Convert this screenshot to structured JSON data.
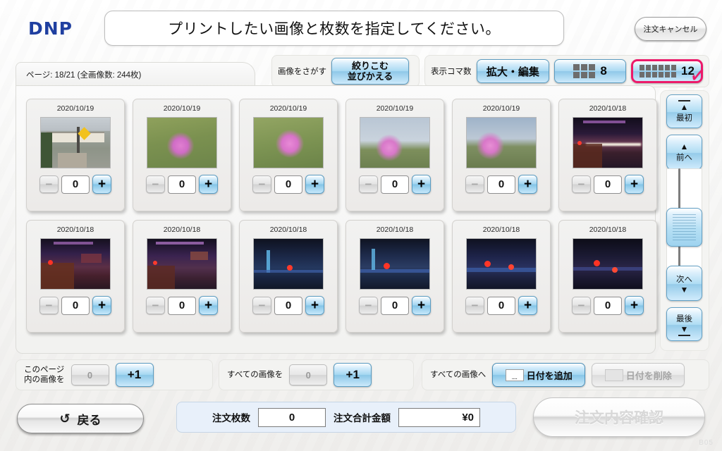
{
  "header": {
    "logo": "DNP",
    "title": "プリントしたい画像と枚数を指定してください。",
    "cancel_label": "注文キャンセル"
  },
  "subbar": {
    "page_info": "ページ: 18/21 (全画像数: 244枚)",
    "search_label": "画像をさがす",
    "sort_filter_line1": "絞りこむ",
    "sort_filter_line2": "並びかえる",
    "display_label": "表示コマ数",
    "zoom_edit_label": "拡大・編集",
    "frames_8": "8",
    "frames_12": "12",
    "accent_color": "#ec1a6a"
  },
  "photos": [
    {
      "date": "2020/10/19",
      "qty": "0",
      "scene": "railway-crossing-street"
    },
    {
      "date": "2020/10/19",
      "qty": "0",
      "scene": "pink-cosmos-closeup"
    },
    {
      "date": "2020/10/19",
      "qty": "0",
      "scene": "pink-cosmos-bee"
    },
    {
      "date": "2020/10/19",
      "qty": "0",
      "scene": "cosmos-cloudy-sky"
    },
    {
      "date": "2020/10/19",
      "qty": "0",
      "scene": "cosmos-roadside-sky"
    },
    {
      "date": "2020/10/18",
      "qty": "0",
      "scene": "night-station-lighttrail"
    },
    {
      "date": "2020/10/18",
      "qty": "0",
      "scene": "night-red-flowers-trail"
    },
    {
      "date": "2020/10/18",
      "qty": "0",
      "scene": "night-station-purple"
    },
    {
      "date": "2020/10/18",
      "qty": "0",
      "scene": "night-blue-rails"
    },
    {
      "date": "2020/10/18",
      "qty": "0",
      "scene": "night-red-flower-rails"
    },
    {
      "date": "2020/10/18",
      "qty": "0",
      "scene": "night-red-flowers-blue"
    },
    {
      "date": "2020/10/18",
      "qty": "0",
      "scene": "night-red-flowers-dark"
    }
  ],
  "stepper": {
    "minus": "−",
    "plus": "+"
  },
  "nav": {
    "first": "最初",
    "prev": "前へ",
    "next": "次へ",
    "last": "最後",
    "up_triangle": "▲",
    "down_triangle": "▼"
  },
  "actions": {
    "page_label_line1": "このページ",
    "page_label_line2": "内の画像を",
    "page_value": "0",
    "page_plus1": "+1",
    "all_label": "すべての画像を",
    "all_value": "0",
    "all_plus1": "+1",
    "date_label": "すべての画像へ",
    "add_date": "日付を追加",
    "del_date": "日付を削除",
    "swatch_text": "...."
  },
  "footer": {
    "back_label": "戻る",
    "back_icon": "↺",
    "order_count_label": "注文枚数",
    "order_count_value": "0",
    "order_total_label": "注文合計金額",
    "order_total_value": "¥0",
    "confirm_label": "注文内容確認",
    "watermark": "B05"
  }
}
